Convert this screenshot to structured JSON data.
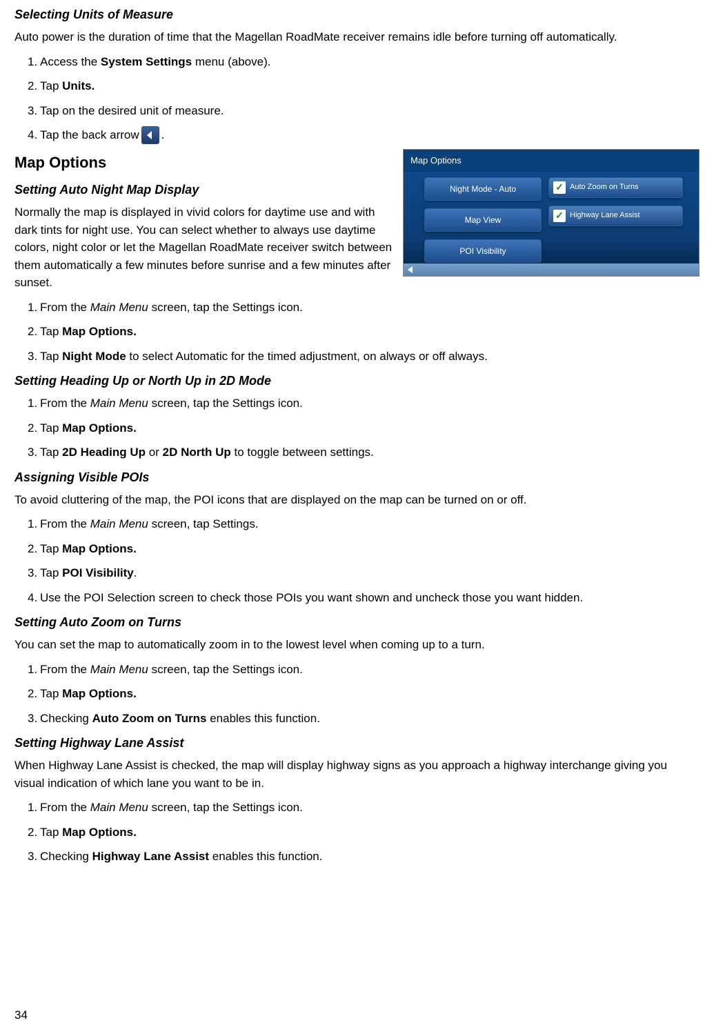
{
  "section1": {
    "title": "Selecting Units of Measure",
    "desc": "Auto power is the duration of time that the Magellan RoadMate receiver remains idle before turning off automatically.",
    "steps": [
      {
        "num": "1.",
        "pre": "Access the ",
        "bold": "System Settings",
        "post": " menu (above)."
      },
      {
        "num": "2.",
        "pre": "Tap ",
        "bold": "Units.",
        "post": ""
      },
      {
        "num": "3.",
        "pre": "Tap on the desired unit of measure.",
        "bold": "",
        "post": ""
      }
    ],
    "step4": {
      "num": "4.",
      "pre": "Tap the back arrow ",
      "post": " ."
    }
  },
  "h2": "Map Options",
  "section2": {
    "title": "Setting Auto Night Map Display",
    "desc": "Normally the map is displayed in vivid colors for daytime use and with dark tints for night use. You can select whether to always use daytime colors, night color or let the Magellan RoadMate receiver switch between them automatically a few minutes before sunrise and a few minutes after sunset.",
    "steps": [
      {
        "num": "1.",
        "preItalic": "From the ",
        "italic": "Main Menu",
        "postItalic": " screen, tap the Settings icon."
      },
      {
        "num": "2.",
        "pre": "Tap ",
        "bold": "Map Options.",
        "post": ""
      },
      {
        "num": "3.",
        "pre": "Tap ",
        "bold": "Night Mode",
        "post": " to select Automatic for the timed adjustment, on always or off always."
      }
    ]
  },
  "section3": {
    "title": "Setting Heading Up or North Up in 2D Mode",
    "steps": [
      {
        "num": "1.",
        "preItalic": "From the ",
        "italic": "Main Menu",
        "postItalic": " screen, tap the Settings icon."
      },
      {
        "num": "2.",
        "pre": "Tap ",
        "bold": "Map Options.",
        "post": ""
      },
      {
        "num": "3.",
        "pre": "Tap ",
        "bold1": "2D Heading Up",
        "mid": " or ",
        "bold2": "2D North Up",
        "post": " to toggle between settings."
      }
    ]
  },
  "section4": {
    "title": "Assigning Visible POIs",
    "desc": "To avoid cluttering of the map, the POI icons that are displayed on the map can be turned on or off.",
    "steps": [
      {
        "num": "1.",
        "preItalic": "From the ",
        "italic": "Main Menu",
        "postItalic": " screen, tap Settings."
      },
      {
        "num": "2.",
        "pre": "Tap ",
        "bold": "Map Options.",
        "post": ""
      },
      {
        "num": "3.",
        "pre": "Tap ",
        "bold": "POI Visibility",
        "post": "."
      },
      {
        "num": "4.",
        "plain": "Use the POI Selection screen to check those POIs you want shown and uncheck those you want hidden."
      }
    ]
  },
  "section5": {
    "title": "Setting Auto Zoom on Turns",
    "desc": "You can set the map to automatically zoom in to the lowest level when coming up to a turn.",
    "steps": [
      {
        "num": "1.",
        "preItalic": "From the ",
        "italic": "Main Menu",
        "postItalic": " screen, tap the Settings icon."
      },
      {
        "num": "2.",
        "pre": "Tap ",
        "bold": "Map Options.",
        "post": ""
      },
      {
        "num": "3.",
        "pre": "Checking ",
        "bold": "Auto Zoom on Turns",
        "post": " enables this function."
      }
    ]
  },
  "section6": {
    "title": "Setting Highway Lane Assist",
    "desc": "When Highway Lane Assist is checked, the map will display highway signs as you approach a highway interchange giving you visual indication of which lane you want to be in.",
    "steps": [
      {
        "num": "1.",
        "preItalic": "From the ",
        "italic": "Main Menu",
        "postItalic": " screen, tap the Settings icon."
      },
      {
        "num": "2.",
        "pre": "Tap ",
        "bold": "Map Options.",
        "post": ""
      },
      {
        "num": "3.",
        "pre": "Checking ",
        "bold": "Highway Lane Assist",
        "post": " enables this function."
      }
    ]
  },
  "screenshot": {
    "title": "Map Options",
    "leftButtons": [
      "Night Mode - Auto",
      "Map View",
      "POI Visibility"
    ],
    "rightButtons": [
      "Auto Zoom on Turns",
      "Highway Lane Assist"
    ]
  },
  "pageNum": "34"
}
